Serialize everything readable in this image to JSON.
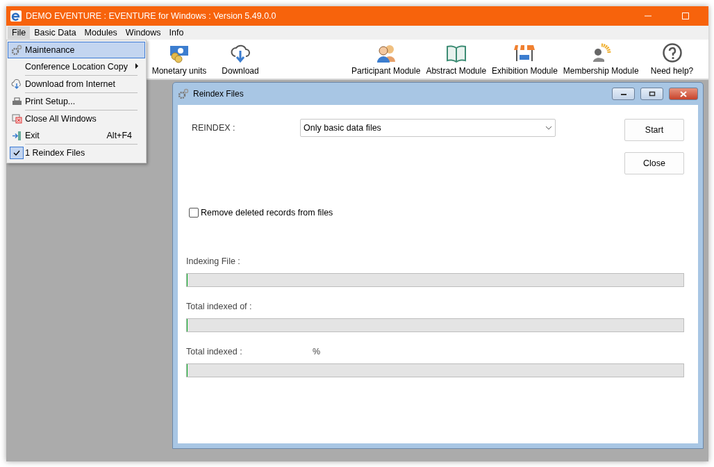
{
  "window": {
    "title": "DEMO EVENTURE : EVENTURE for Windows : Version 5.49.0.0"
  },
  "menu_bar": [
    {
      "label": "File",
      "selected": true
    },
    {
      "label": "Basic Data",
      "selected": false
    },
    {
      "label": "Modules",
      "selected": false
    },
    {
      "label": "Windows",
      "selected": false
    },
    {
      "label": "Info",
      "selected": false
    }
  ],
  "file_menu": [
    {
      "kind": "item",
      "label": "Maintenance",
      "selected": true,
      "checked": false
    },
    {
      "kind": "submenu",
      "label": "Conference Location Copy",
      "selected": false,
      "checked": false
    },
    {
      "kind": "separator"
    },
    {
      "kind": "item",
      "label": "Download from Internet",
      "selected": false,
      "checked": false
    },
    {
      "kind": "separator"
    },
    {
      "kind": "item",
      "label": "Print Setup...",
      "selected": false,
      "checked": false
    },
    {
      "kind": "separator"
    },
    {
      "kind": "item",
      "label": "Close All Windows",
      "selected": false,
      "checked": false
    },
    {
      "kind": "item",
      "label": "Exit",
      "shortcut": "Alt+F4",
      "selected": false,
      "checked": false
    },
    {
      "kind": "separator"
    },
    {
      "kind": "item",
      "label": "1 Reindex Files",
      "selected": false,
      "checked": true
    }
  ],
  "toolbar": [
    {
      "label": "Monetary units",
      "kind": "money"
    },
    {
      "label": "Download",
      "kind": "download"
    },
    {
      "kind": "spacer"
    },
    {
      "label": "Participant Module",
      "kind": "people"
    },
    {
      "label": "Abstract Module",
      "kind": "book"
    },
    {
      "label": "Exhibition Module",
      "kind": "stand"
    },
    {
      "label": "Membership Module",
      "kind": "member"
    },
    {
      "label": "Need help?",
      "kind": "help"
    }
  ],
  "dialog": {
    "title": "Reindex Files",
    "reindex_label": "REINDEX :",
    "reindex_value": "Only basic data files",
    "buttons": [
      "Start",
      "Close"
    ],
    "remove_deleted": {
      "label": "Remove deleted records from files",
      "checked": false
    },
    "progress": [
      {
        "label": "Indexing File :",
        "level": 0
      },
      {
        "label": "Total indexed  of :",
        "level": 0
      },
      {
        "label": "Total indexed  :",
        "suffix": "%",
        "level": 0
      }
    ]
  }
}
